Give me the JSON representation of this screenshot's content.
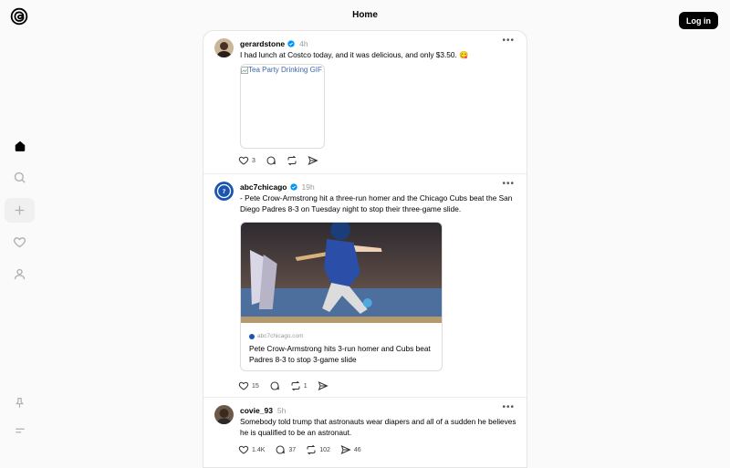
{
  "header": {
    "title": "Home",
    "login_label": "Log in"
  },
  "sidebar": {
    "items": [
      {
        "icon": "home-icon"
      },
      {
        "icon": "search-icon"
      },
      {
        "icon": "create-icon"
      },
      {
        "icon": "heart-icon"
      },
      {
        "icon": "profile-icon"
      }
    ],
    "bottom": [
      {
        "icon": "pin-icon"
      },
      {
        "icon": "menu-icon"
      }
    ]
  },
  "posts": [
    {
      "username": "gerardstone",
      "time": "4h",
      "text": "I had lunch at Costco today, and it was delicious, and only $3.50. 😋",
      "gif_alt": "Tea Party Drinking GIF",
      "likes": "3"
    },
    {
      "username": "abc7chicago",
      "time": "19h",
      "text": "- Pete Crow-Armstrong hit a three-run homer and the Chicago Cubs beat the San Diego Padres 8-3 on Tuesday night to stop their three-game slide.",
      "link": {
        "domain": "abc7chicago.com",
        "title": "Pete Crow-Armstrong hits 3-run homer and Cubs beat Padres 8-3 to stop 3-game slide"
      },
      "likes": "15",
      "reposts": "1"
    },
    {
      "username": "covie_93",
      "time": "5h",
      "text": "Somebody told trump that astronauts wear diapers and all of a sudden he believes he is qualified to be an astronaut.",
      "likes": "1.4K",
      "replies": "37",
      "reposts": "102",
      "shares": "46"
    }
  ],
  "colors": {
    "verified": "#0095f6",
    "login_bg": "#000000"
  }
}
